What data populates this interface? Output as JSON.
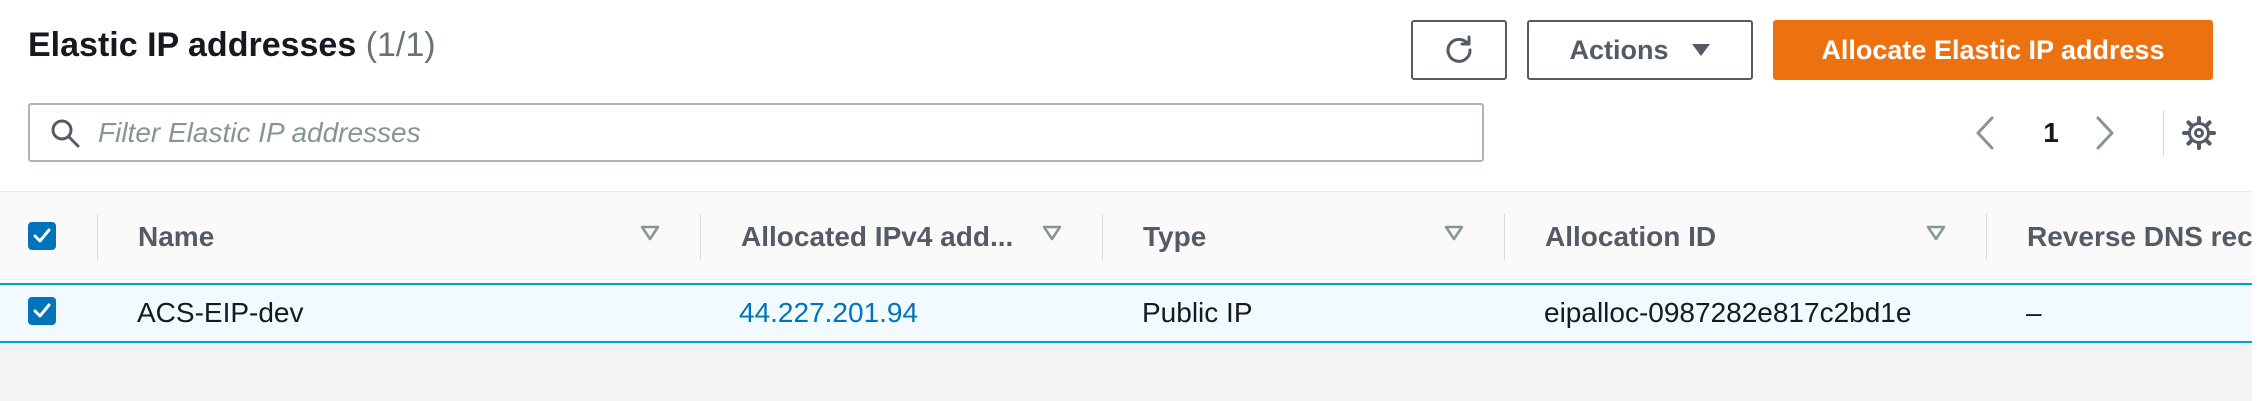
{
  "header": {
    "title": "Elastic IP addresses",
    "count": "(1/1)",
    "actions_label": "Actions",
    "allocate_label": "Allocate Elastic IP address"
  },
  "search": {
    "placeholder": "Filter Elastic IP addresses",
    "value": ""
  },
  "pagination": {
    "current_page": "1"
  },
  "table": {
    "columns": [
      {
        "label": "Name"
      },
      {
        "label": "Allocated IPv4 add..."
      },
      {
        "label": "Type"
      },
      {
        "label": "Allocation ID"
      },
      {
        "label": "Reverse DNS record"
      }
    ],
    "rows": [
      {
        "selected": true,
        "name": "ACS-EIP-dev",
        "allocated_ipv4": "44.227.201.94",
        "type": "Public IP",
        "allocation_id": "eipalloc-0987282e817c2bd1e",
        "reverse_dns": "–"
      }
    ],
    "select_all_checked": true
  },
  "colors": {
    "primary_button": "#ec7211",
    "link": "#0073bb",
    "selected_row_bg": "#f1faff",
    "selected_row_border": "#00a1c9",
    "checkbox": "#0073bb"
  },
  "icons": {
    "refresh": "refresh-icon",
    "actions_caret": "caret-down-icon",
    "search": "search-icon",
    "prev_page": "chevron-left-icon",
    "next_page": "chevron-right-icon",
    "settings": "gear-icon",
    "sort": "sort-caret-icon",
    "checkbox": "checkmark-icon"
  }
}
